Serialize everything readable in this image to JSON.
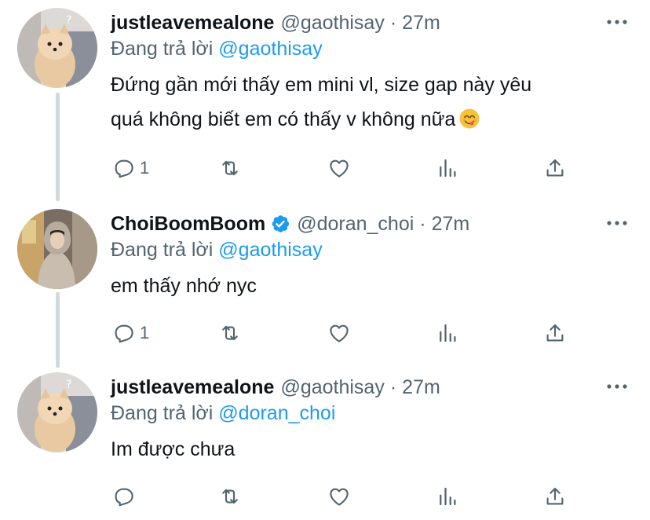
{
  "tweets": [
    {
      "name": "justleavemealone",
      "handle": "@gaothisay",
      "dot": "·",
      "time": "27m",
      "replying_prefix": "Đang trả lời",
      "replying_to": "@gaothisay",
      "text_line1": "Đứng gần mới thấy em mini vl, size gap này yêu",
      "text_line2": "quá không biết em có thấy v không nữa",
      "emoji": "yum-face-emoji",
      "reply_count": "1",
      "verified": false,
      "avatar": "pomeranian-dog-avatar"
    },
    {
      "name": "ChoiBoomBoom",
      "handle": "@doran_choi",
      "dot": "·",
      "time": "27m",
      "replying_prefix": "Đang trả lời",
      "replying_to": "@gaothisay",
      "text_line1": "em thấy nhớ nyc",
      "reply_count": "1",
      "verified": true,
      "avatar": "hooded-person-avatar"
    },
    {
      "name": "justleavemealone",
      "handle": "@gaothisay",
      "dot": "·",
      "time": "27m",
      "replying_prefix": "Đang trả lời",
      "replying_to": "@doran_choi",
      "text_line1": "Im được chưa",
      "reply_count": "",
      "verified": false,
      "avatar": "pomeranian-dog-avatar"
    }
  ],
  "colors": {
    "text": "#0f1419",
    "secondary": "#536471",
    "link": "#1d9bf0",
    "thread_line": "#cfd9de",
    "verified": "#1d9bf0"
  },
  "icons": {
    "more": "more-horizontal-icon",
    "reply": "reply-bubble-icon",
    "retweet": "retweet-icon",
    "like": "heart-icon",
    "views": "views-bar-chart-icon",
    "share": "share-upload-icon",
    "verified": "verified-badge-icon"
  }
}
